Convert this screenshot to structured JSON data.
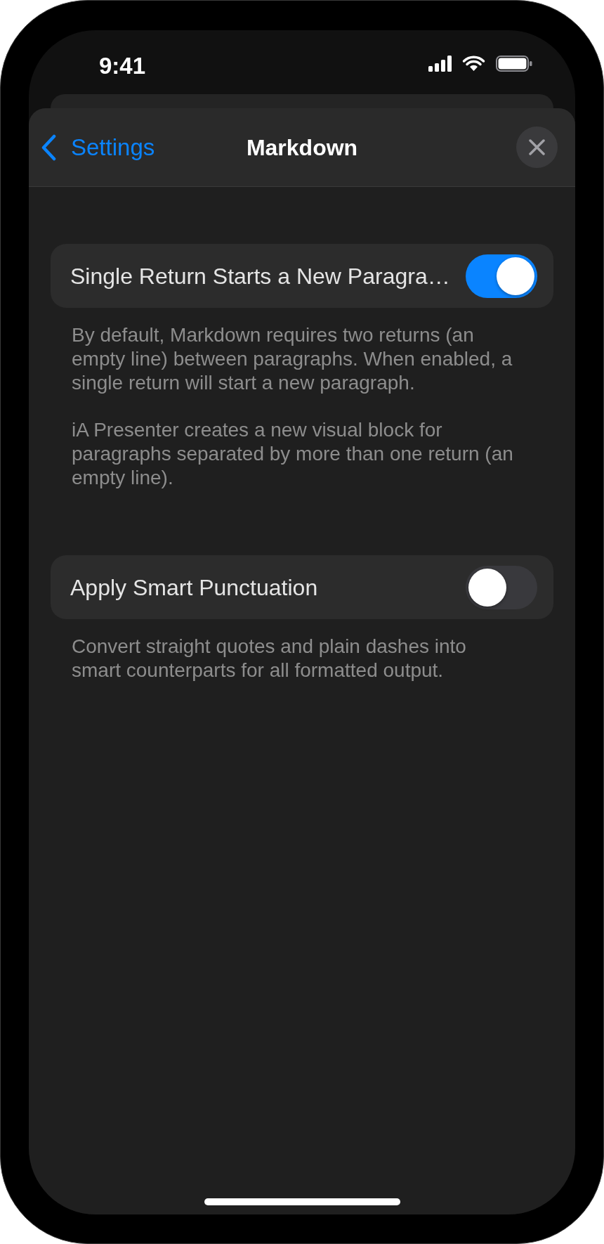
{
  "status_bar": {
    "time": "9:41"
  },
  "navigation": {
    "back_label": "Settings",
    "title": "Markdown"
  },
  "settings": [
    {
      "label": "Single Return Starts a New Paragra…",
      "on": true,
      "description": [
        "By default, Markdown requires two returns (an empty line) between paragraphs. When enabled, a single return will start a new paragraph.",
        "iA Presenter creates a new visual block for paragraphs separated by more than one return (an empty line)."
      ]
    },
    {
      "label": "Apply Smart Punctuation",
      "on": false,
      "description": [
        "Convert straight quotes and plain dashes into smart counterparts for all formatted output."
      ]
    }
  ]
}
